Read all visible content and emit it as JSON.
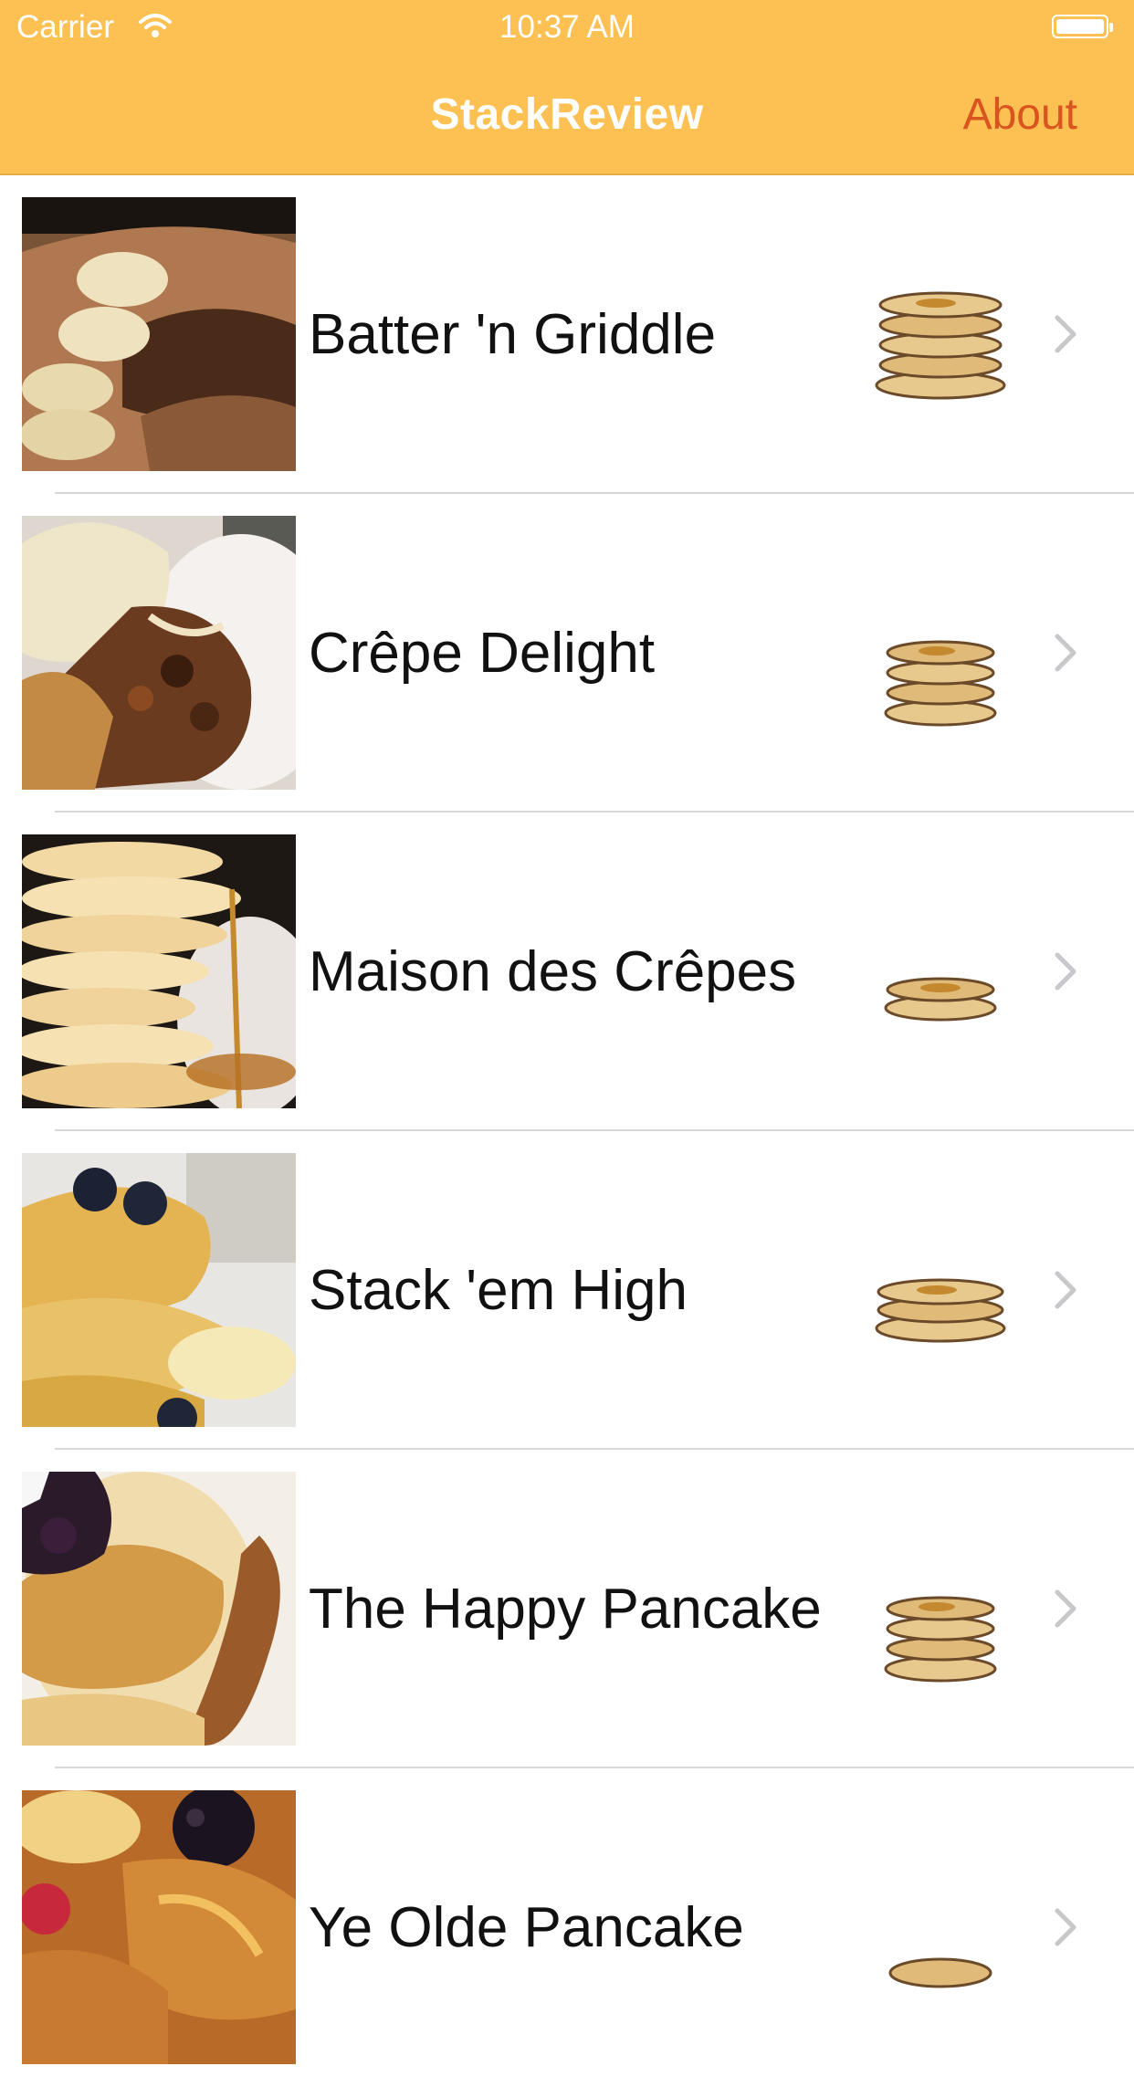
{
  "status_bar": {
    "carrier": "Carrier",
    "time": "10:37 AM"
  },
  "nav": {
    "title": "StackReview",
    "about_label": "About"
  },
  "restaurants": [
    {
      "name": "Batter 'n Griddle",
      "rating": 5
    },
    {
      "name": "Crêpe Delight",
      "rating": 4
    },
    {
      "name": "Maison des Crêpes",
      "rating": 2
    },
    {
      "name": "Stack 'em High",
      "rating": 3
    },
    {
      "name": "The Happy Pancake",
      "rating": 4
    },
    {
      "name": "Ye Olde Pancake",
      "rating": 1
    }
  ],
  "colors": {
    "nav_bg": "#fdc153",
    "accent": "#d9541e",
    "pancake": "#d9a85a"
  }
}
